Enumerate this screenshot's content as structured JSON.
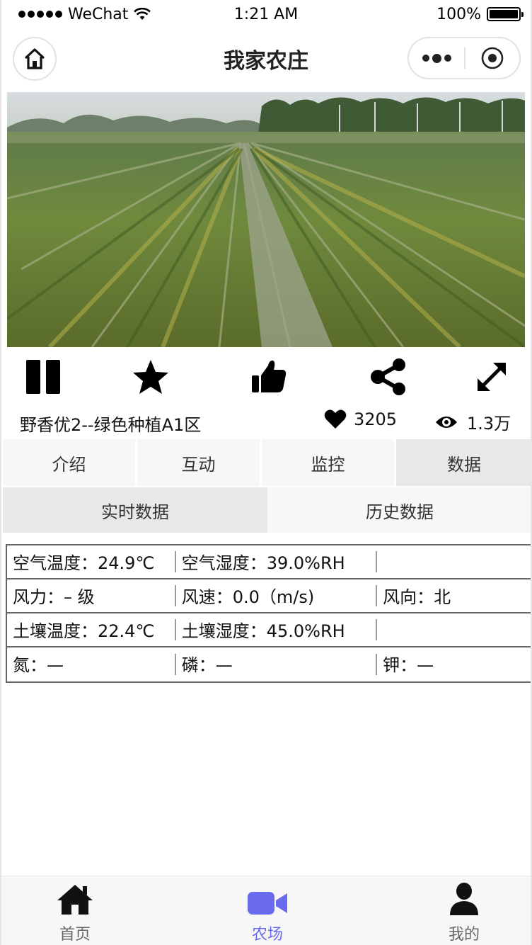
{
  "status_bar": {
    "carrier": "WeChat",
    "time": "1:21 AM",
    "battery": "100%"
  },
  "nav": {
    "title": "我家农庄"
  },
  "hero": {
    "icon": "rice-field-photo"
  },
  "toolbar": {
    "icons": [
      "pause-icon",
      "star-icon",
      "thumbs-up-icon",
      "share-icon",
      "expand-icon"
    ]
  },
  "info": {
    "crop_title": "野香优2--绿色种植A1区",
    "likes": "3205",
    "views": "1.3万"
  },
  "main_tabs": [
    {
      "label": "介绍"
    },
    {
      "label": "互动"
    },
    {
      "label": "监控"
    },
    {
      "label": "数据"
    }
  ],
  "sub_tabs": [
    {
      "label": "实时数据"
    },
    {
      "label": "历史数据"
    }
  ],
  "sensor_rows": [
    [
      "空气温度：24.9℃",
      "空气湿度：39.0%RH",
      ""
    ],
    [
      "风力：– 级",
      "风速：0.0（m/s)",
      "风向：北"
    ],
    [
      "土壤温度：22.4℃",
      "土壤湿度：45.0%RH",
      ""
    ],
    [
      "氮：—",
      "磷：—",
      "钾：—"
    ]
  ],
  "tab_bar": [
    {
      "label": "首页",
      "icon": "home-icon"
    },
    {
      "label": "农场",
      "icon": "video-camera-icon"
    },
    {
      "label": "我的",
      "icon": "user-icon"
    }
  ],
  "colors": {
    "accent": "#6a6aee",
    "tab_active_bg": "#e8e8e8",
    "tab_bg": "#f7f7f7"
  }
}
